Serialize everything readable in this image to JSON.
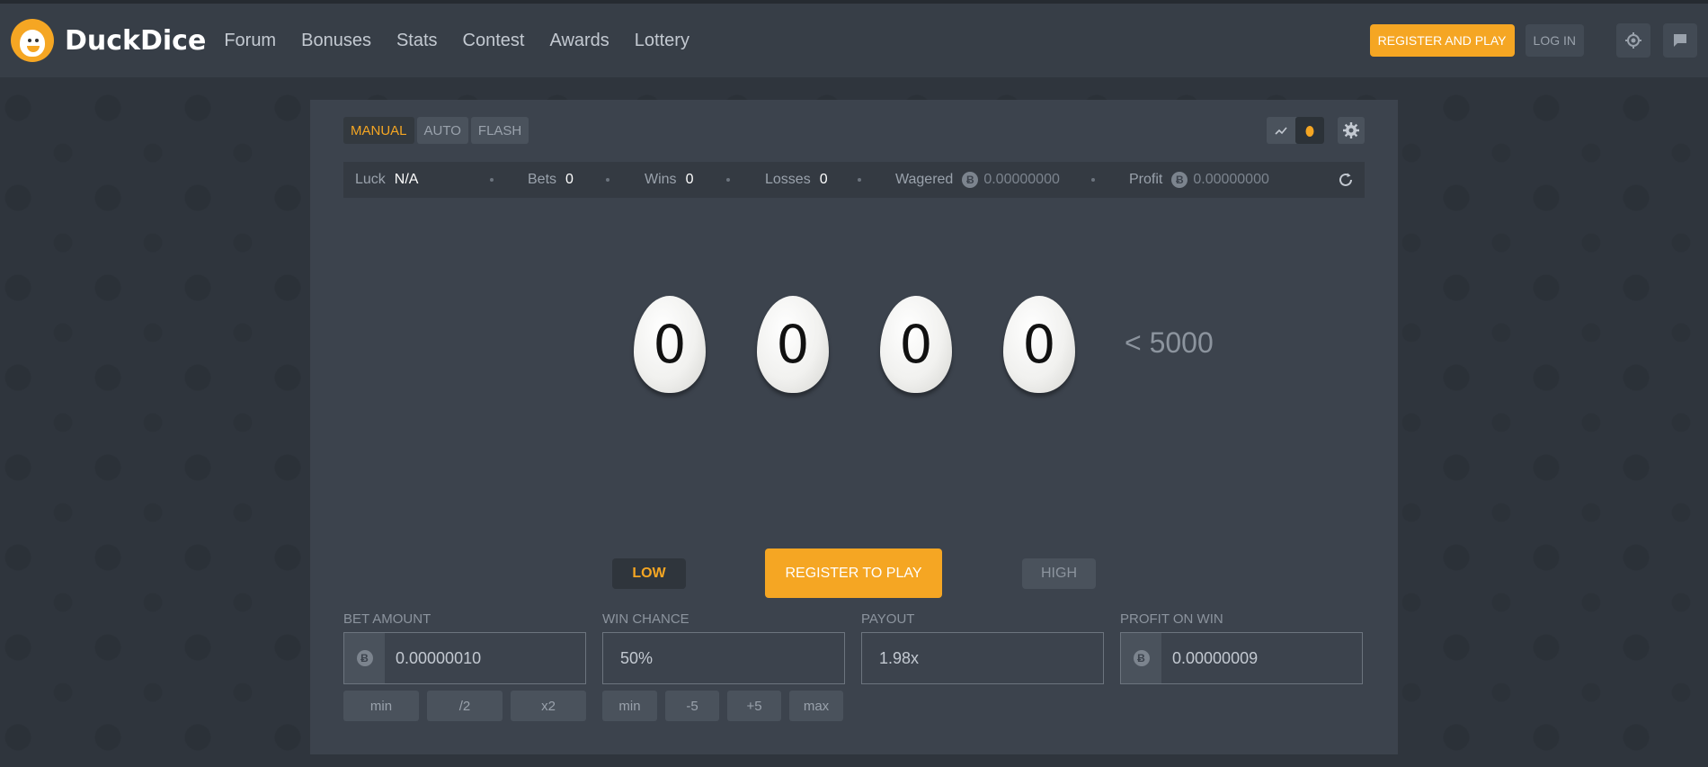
{
  "header": {
    "brand": "DuckDice",
    "nav": [
      "Forum",
      "Bonuses",
      "Stats",
      "Contest",
      "Awards",
      "Lottery"
    ],
    "register_label": "REGISTER AND PLAY",
    "login_label": "LOG IN"
  },
  "game": {
    "modes": [
      "MANUAL",
      "AUTO",
      "FLASH"
    ],
    "active_mode": "MANUAL",
    "stats": {
      "luck_label": "Luck",
      "luck": "N/A",
      "bets_label": "Bets",
      "bets": "0",
      "wins_label": "Wins",
      "wins": "0",
      "losses_label": "Losses",
      "losses": "0",
      "wagered_label": "Wagered",
      "wagered": "0.00000000",
      "profit_label": "Profit",
      "profit": "0.00000000"
    },
    "eggs": [
      "0",
      "0",
      "0",
      "0"
    ],
    "target": "< 5000",
    "low_label": "LOW",
    "play_label": "REGISTER TO PLAY",
    "high_label": "HIGH",
    "bet_amount": {
      "label": "BET AMOUNT",
      "value": "0.00000010",
      "buttons": [
        "min",
        "/2",
        "x2"
      ]
    },
    "win_chance": {
      "label": "WIN CHANCE",
      "value": "50%",
      "buttons": [
        "min",
        "-5",
        "+5",
        "max"
      ]
    },
    "payout": {
      "label": "PAYOUT",
      "value": "1.98x"
    },
    "profit_on_win": {
      "label": "PROFIT ON WIN",
      "value": "0.00000009"
    },
    "currency_symbol": "Ƀ"
  },
  "colors": {
    "accent": "#f5a623",
    "bg": "#2f353d",
    "panel": "#3c434d"
  }
}
